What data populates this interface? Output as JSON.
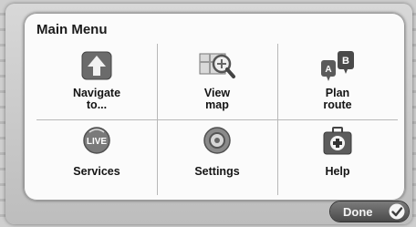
{
  "menu": {
    "title": "Main Menu",
    "items": [
      {
        "label": "Navigate\nto...",
        "icon": "navigate-arrow-icon"
      },
      {
        "label": "View\nmap",
        "icon": "map-magnifier-icon"
      },
      {
        "label": "Plan\nroute",
        "icon": "route-a-b-icon"
      },
      {
        "label": "Services",
        "icon": "live-services-icon"
      },
      {
        "label": "Settings",
        "icon": "settings-gear-icon"
      },
      {
        "label": "Help",
        "icon": "first-aid-kit-icon"
      }
    ]
  },
  "done_button": {
    "label": "Done",
    "icon": "checkmark-icon"
  }
}
